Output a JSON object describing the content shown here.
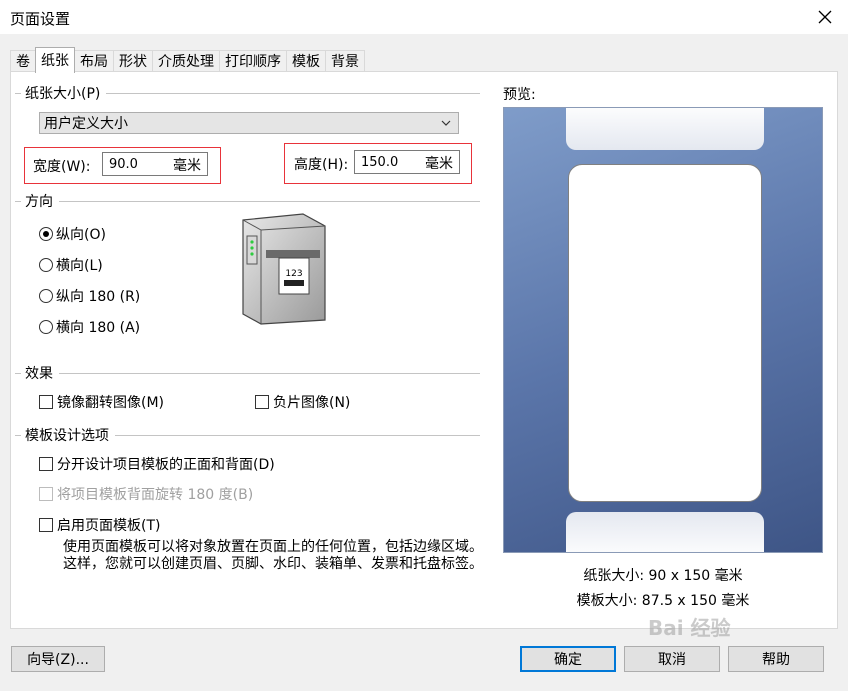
{
  "window": {
    "title": "页面设置"
  },
  "tabs": [
    "卷",
    "纸张",
    "布局",
    "形状",
    "介质处理",
    "打印顺序",
    "模板",
    "背景"
  ],
  "active_tab_index": 1,
  "paper_size": {
    "section_label": "纸张大小(P)",
    "selected": "用户定义大小",
    "width_label": "宽度(W):",
    "width_value": "90.0",
    "height_label": "高度(H):",
    "height_value": "150.0",
    "unit": "毫米"
  },
  "orientation": {
    "section_label": "方向",
    "options": [
      "纵向(O)",
      "横向(L)",
      "纵向 180 (R)",
      "横向 180 (A)"
    ],
    "selected_index": 0,
    "printer_label_text": "123"
  },
  "effects": {
    "section_label": "效果",
    "mirror_label": "镜像翻转图像(M)",
    "negative_label": "负片图像(N)"
  },
  "template_options": {
    "section_label": "模板设计选项",
    "separate_label": "分开设计项目模板的正面和背面(D)",
    "rotate_label": "将项目模板背面旋转 180 度(B)",
    "enable_label": "启用页面模板(T)",
    "description": "使用页面模板可以将对象放置在页面上的任何位置，包括边缘区域。这样，您就可以创建页眉、页脚、水印、装箱单、发票和托盘标签。"
  },
  "preview": {
    "label": "预览:",
    "paper_size_text": "纸张大小:  90 x 150 毫米",
    "template_size_text": "模板大小:  87.5 x 150 毫米"
  },
  "buttons": {
    "wizard": "向导(Z)...",
    "ok": "确定",
    "cancel": "取消",
    "help": "帮助"
  },
  "watermark": "Bai 经验",
  "colors": {
    "highlight": "#e8333a",
    "default_button": "#0078d7"
  }
}
